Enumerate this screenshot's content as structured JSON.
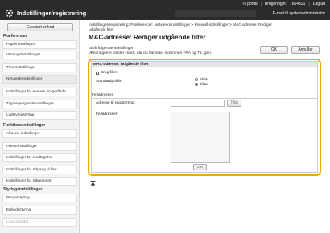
{
  "header": {
    "app_title": "Indstillinger/registrering",
    "top_links": [
      "Til portal",
      "Brugerlogin:",
      "7654321",
      "Log ud"
    ],
    "mail_link": "E-mail til systemadministrator"
  },
  "sidebar": {
    "start_button": "Genstart enhed",
    "sections": [
      {
        "title": "Præferencer",
        "items": [
          "Papirindstillinger",
          "Visningsindstillinger",
          "Timerindstillinger",
          "Netværksindstillinger",
          "Indstillinger for ekstern brugerflade",
          "Tilgængelighedsindstillinger",
          "Lydstyrkestyring"
        ]
      },
      {
        "title": "Funktionsindstillinger",
        "items": [
          "Almene indstillinger",
          "Printerindstillinger",
          "Indstillinger for modtagelse",
          "Indstillinger for Adgang til filer",
          "Indstillinger for Sikret print"
        ]
      },
      {
        "title": "Styringsindstillinger",
        "items": [
          "Brugerstyring",
          "Enhedsstyring",
          "Licens/andet"
        ]
      }
    ]
  },
  "main": {
    "breadcrumb_line1": "Indstillinger/registrering: Præferencer: Netværksindstillinger > Firewall-indstillinger > MAC-adresse: Rediger",
    "breadcrumb_line2": "udgående filter",
    "title": "MAC-adresse: Rediger udgående filter",
    "info_line1": "Skift følgende indstillinger.",
    "info_line2": "Ændringerne træder i kraft, når du har slået strømmen FRA og TIL igen.",
    "ok_label": "OK",
    "cancel_label": "Annuller"
  },
  "panel": {
    "heading": "MAC-adresse: Udgående filter",
    "use_filter_label": "Brug filter",
    "policy_label": "Standardpolitik:",
    "policy_options": [
      "Afvis",
      "Tillad"
    ],
    "policy_selected": "Tillad",
    "filter_addresses_heading": "Fejladresser",
    "address_label": "Adresse til registrering:",
    "add_button": "Tilføj",
    "filter_list_label": "Fejladresser:",
    "delete_button": "Slet"
  },
  "colors": {
    "topbar": "#2b2b2b",
    "highlight_border": "#f0a800",
    "sidebar_bg": "#f3f3f3"
  }
}
